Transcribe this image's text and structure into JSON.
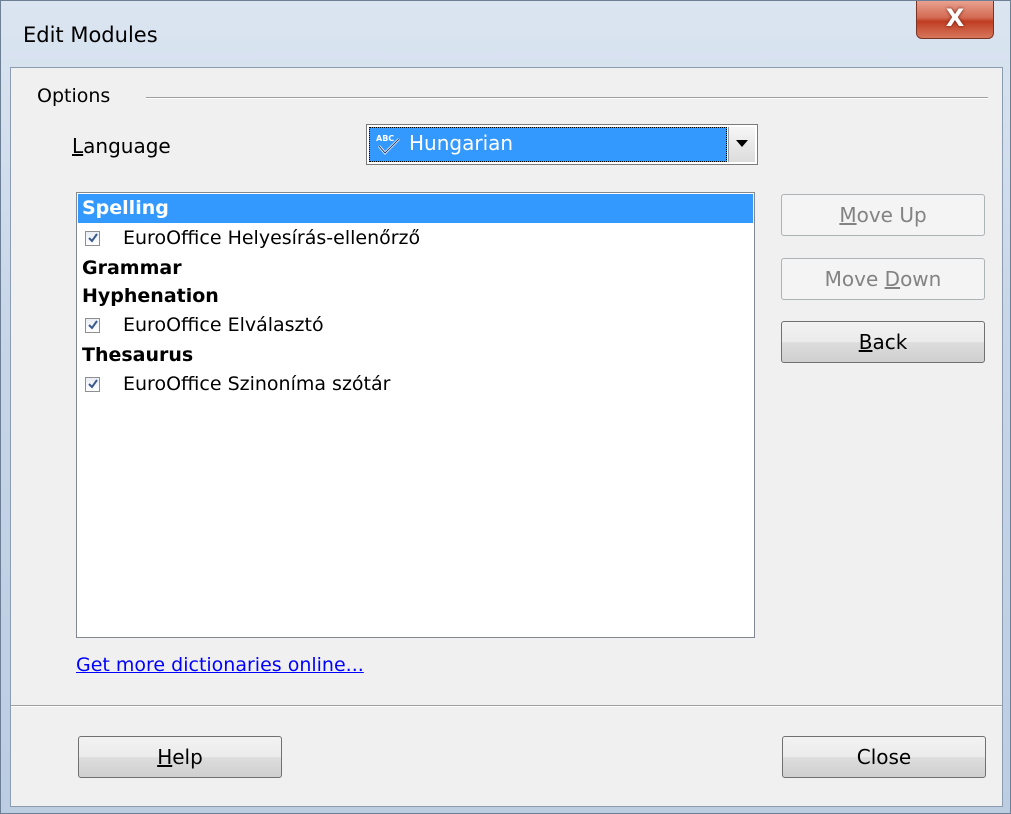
{
  "window": {
    "title": "Edit Modules",
    "close_glyph": "X"
  },
  "options": {
    "group_label": "Options",
    "language_label_prefix": "L",
    "language_label_rest": "anguage",
    "language_value": "Hungarian",
    "language_icon": "spellcheck-abc-icon"
  },
  "modules": [
    {
      "type": "header",
      "label": "Spelling",
      "selected": true
    },
    {
      "type": "item",
      "label": "EuroOffice Helyesírás-ellenőrző",
      "checked": true
    },
    {
      "type": "header",
      "label": "Grammar",
      "selected": false
    },
    {
      "type": "header",
      "label": "Hyphenation",
      "selected": false
    },
    {
      "type": "item",
      "label": "EuroOffice Elválasztó",
      "checked": true
    },
    {
      "type": "header",
      "label": "Thesaurus",
      "selected": false
    },
    {
      "type": "item",
      "label": "EuroOffice Szinoníma szótár",
      "checked": true
    }
  ],
  "buttons": {
    "move_up_pre": "",
    "move_up_key": "M",
    "move_up_post": "ove Up",
    "move_down_pre": "Move ",
    "move_down_key": "D",
    "move_down_post": "own",
    "back_pre": "",
    "back_key": "B",
    "back_post": "ack",
    "help_pre": "",
    "help_key": "H",
    "help_post": "elp",
    "close": "Close"
  },
  "link": {
    "text": "Get more dictionaries online..."
  },
  "colors": {
    "selection": "#3399ff",
    "link": "#0000ff"
  }
}
